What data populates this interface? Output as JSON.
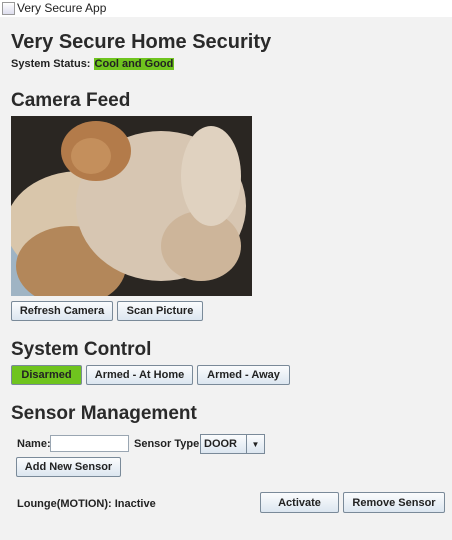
{
  "window": {
    "title": "Very Secure App"
  },
  "header": {
    "title": "Very Secure Home Security",
    "status_label": "System Status:",
    "status_value": "Cool and Good",
    "status_color": "#6fc41e"
  },
  "camera": {
    "heading": "Camera Feed",
    "refresh_label": "Refresh Camera",
    "scan_label": "Scan Picture"
  },
  "control": {
    "heading": "System Control",
    "modes": [
      "Disarmed",
      "Armed - At Home",
      "Armed - Away"
    ],
    "active_mode": "Disarmed"
  },
  "sensors": {
    "heading": "Sensor Management",
    "name_label": "Name:",
    "name_value": "",
    "type_label": "Sensor Type:",
    "type_value": "DOOR",
    "add_label": "Add New Sensor",
    "items": [
      {
        "text": "Lounge(MOTION): Inactive",
        "activate_label": "Activate",
        "remove_label": "Remove Sensor"
      }
    ]
  }
}
